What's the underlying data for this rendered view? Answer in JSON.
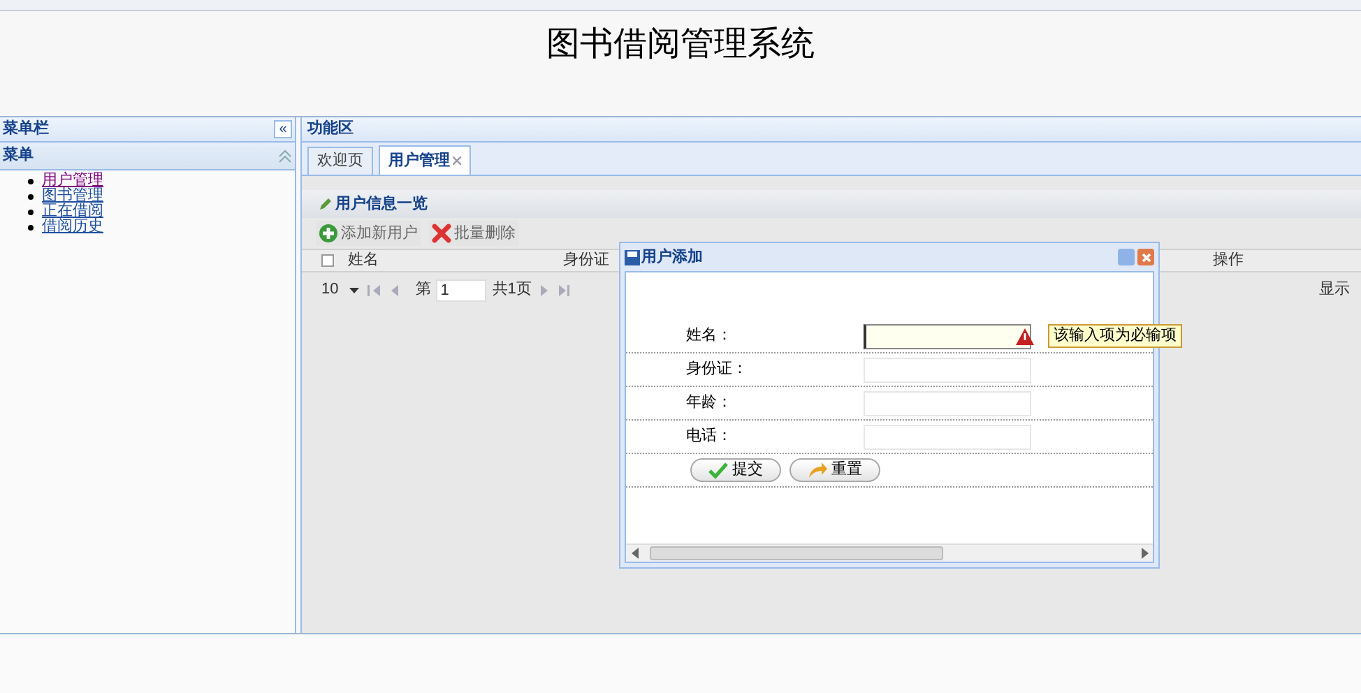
{
  "header": {
    "title": "图书借阅管理系统"
  },
  "sidebar": {
    "title": "菜单栏",
    "collapse": "«",
    "section": {
      "title": "菜单",
      "expanded": true,
      "items": [
        {
          "label": "用户管理",
          "selected": true
        },
        {
          "label": "图书管理",
          "selected": false
        },
        {
          "label": "正在借阅",
          "selected": false
        },
        {
          "label": "借阅历史",
          "selected": false
        }
      ]
    }
  },
  "main": {
    "title": "功能区",
    "tabs": [
      {
        "label": "欢迎页",
        "selected": false,
        "closable": false
      },
      {
        "label": "用户管理",
        "selected": true,
        "closable": true
      }
    ],
    "panel": {
      "title": "用户信息一览",
      "toolbar": [
        {
          "label": "添加新用户",
          "kind": "add"
        },
        {
          "label": "批量删除",
          "kind": "delete"
        }
      ],
      "select_all": {
        "checked": false
      },
      "columns": [
        "姓名",
        "身份证",
        "操作"
      ],
      "pager": {
        "page_size": "10",
        "page_label": "第",
        "page": "1",
        "total": "共1页",
        "info": "显示"
      }
    }
  },
  "dialog": {
    "title": "用户添加",
    "fields": [
      {
        "label": "姓名：",
        "invalid": true,
        "error": "该输入项为必输项"
      },
      {
        "label": "身份证：",
        "invalid": false
      },
      {
        "label": "年龄：",
        "invalid": false
      },
      {
        "label": "电话：",
        "invalid": false
      }
    ],
    "buttons": [
      {
        "label": "提交",
        "kind": "submit"
      },
      {
        "label": "重置",
        "kind": "reset"
      }
    ]
  }
}
